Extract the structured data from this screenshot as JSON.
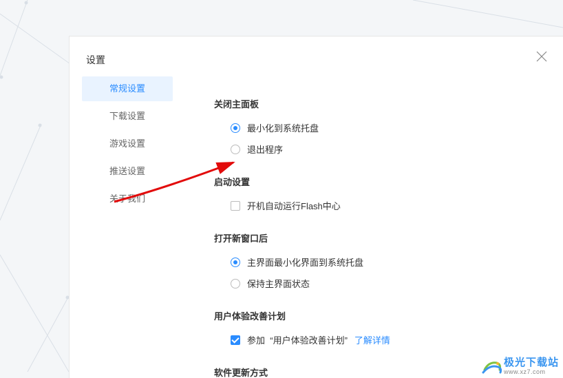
{
  "title": "设置",
  "sidebar": {
    "items": [
      {
        "label": "常规设置",
        "active": true
      },
      {
        "label": "下载设置",
        "active": false
      },
      {
        "label": "游戏设置",
        "active": false
      },
      {
        "label": "推送设置",
        "active": false
      },
      {
        "label": "关于我们",
        "active": false
      }
    ]
  },
  "sections": {
    "close_panel": {
      "title": "关闭主面板",
      "opt_tray": "最小化到系统托盘",
      "opt_exit": "退出程序"
    },
    "startup": {
      "title": "启动设置",
      "opt_autorun": "开机自动运行Flash中心"
    },
    "newwin": {
      "title": "打开新窗口后",
      "opt_min": "主界面最小化界面到系统托盘",
      "opt_keep": "保持主界面状态"
    },
    "uex": {
      "title": "用户体验改善计划",
      "opt_join_prefix": "参加",
      "opt_join_quoted": "“用户体验改善计划”",
      "link": "了解详情"
    },
    "update": {
      "title": "软件更新方式"
    }
  },
  "watermark": {
    "cn": "极光下载站",
    "url": "www.xz7.com"
  }
}
